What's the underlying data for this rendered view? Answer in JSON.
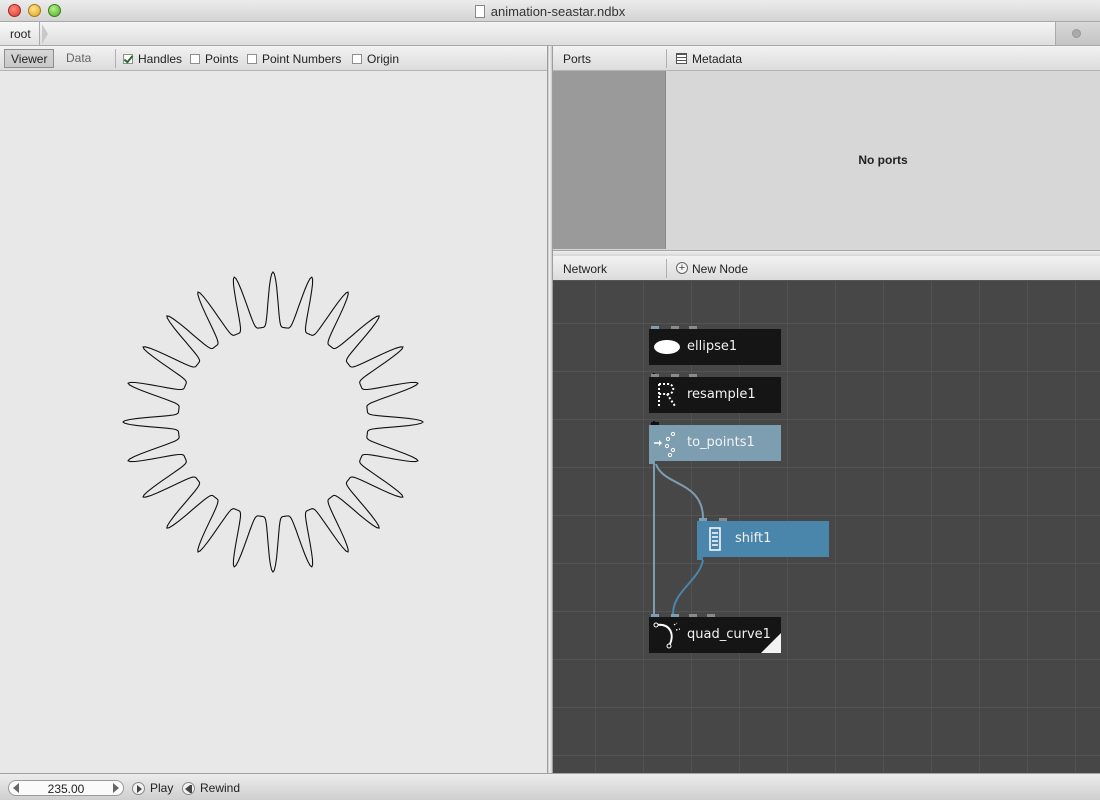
{
  "window": {
    "title": "animation-seastar.ndbx"
  },
  "breadcrumb": {
    "root": "root"
  },
  "viewer": {
    "tabs": [
      {
        "label": "Viewer",
        "active": true
      },
      {
        "label": "Data",
        "active": false
      }
    ],
    "options": [
      {
        "label": "Handles",
        "checked": true
      },
      {
        "label": "Points",
        "checked": false
      },
      {
        "label": "Point Numbers",
        "checked": false
      },
      {
        "label": "Origin",
        "checked": false
      }
    ]
  },
  "ports_panel": {
    "title": "Ports",
    "metadata_label": "Metadata",
    "empty_text": "No ports"
  },
  "network_panel": {
    "title": "Network",
    "new_node_label": "New Node"
  },
  "nodes": [
    {
      "name": "ellipse1",
      "icon": "ellipse-icon",
      "style": "dark"
    },
    {
      "name": "resample1",
      "icon": "resample-icon",
      "style": "dark"
    },
    {
      "name": "to_points1",
      "icon": "to-points-icon",
      "style": "selected"
    },
    {
      "name": "shift1",
      "icon": "shift-icon",
      "style": "active"
    },
    {
      "name": "quad_curve1",
      "icon": "quad-curve-icon",
      "style": "rendered"
    }
  ],
  "statusbar": {
    "frame": "235.00",
    "play_label": "Play",
    "rewind_label": "Rewind"
  },
  "colors": {
    "node_dark": "#151515",
    "node_selected": "#7d9db1",
    "node_active": "#4a85ab",
    "network_bg": "#474747",
    "wire": "#7d9db1"
  }
}
